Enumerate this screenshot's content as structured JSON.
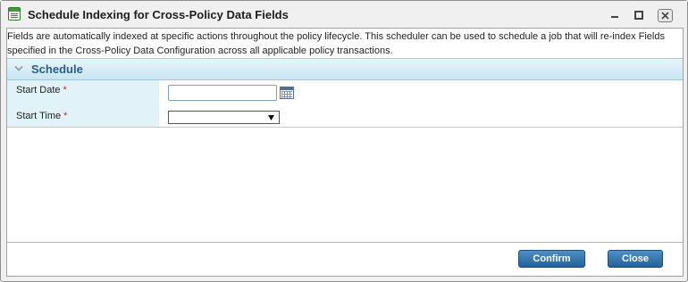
{
  "window": {
    "title": "Schedule Indexing for Cross-Policy Data Fields"
  },
  "description": "Fields are automatically indexed at specific actions throughout the policy lifecycle. This scheduler can be used to schedule a job that will re-index Fields specified in the Cross-Policy Data Configuration across all applicable policy transactions.",
  "section": {
    "title": "Schedule"
  },
  "form": {
    "start_date": {
      "label": "Start Date",
      "required_marker": "*",
      "value": ""
    },
    "start_time": {
      "label": "Start Time",
      "required_marker": "*",
      "selected": "",
      "arrow": "▼"
    }
  },
  "buttons": {
    "confirm": "Confirm",
    "close": "Close"
  },
  "icons": {
    "app": "document-list-icon",
    "minimize": "minimize-icon",
    "maximize": "maximize-icon",
    "close": "close-icon",
    "collapse": "chevron-down-icon",
    "calendar": "calendar-icon"
  },
  "colors": {
    "section_header": "#c9e6f2",
    "section_title": "#2a5d86",
    "label_column": "#e1f3f9",
    "required": "#cc2222",
    "button": "#23619a"
  }
}
